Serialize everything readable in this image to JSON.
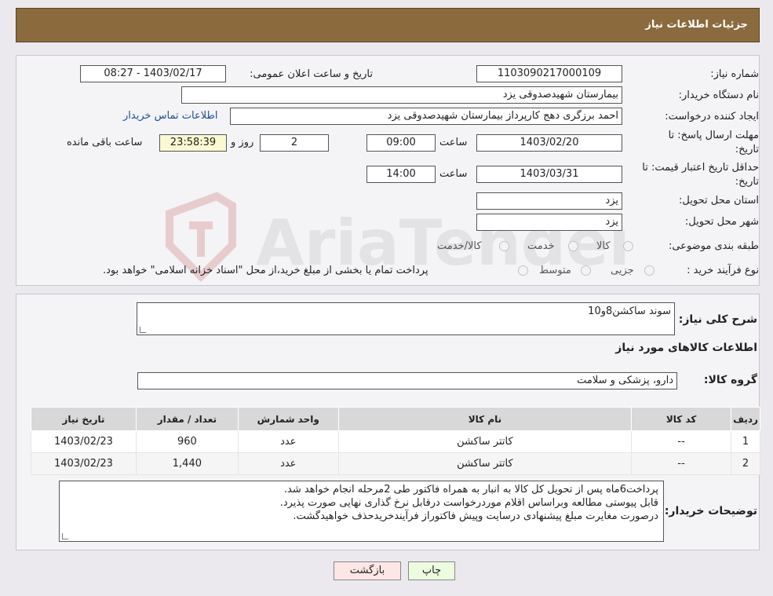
{
  "header": {
    "title": "جزئیات اطلاعات نیاز"
  },
  "form": {
    "need_number_label": "شماره نیاز:",
    "need_number": "1103090217000109",
    "announce_label": "تاریخ و ساعت اعلان عمومی:",
    "announce_value": "1403/02/17 - 08:27",
    "buyer_org_label": "نام دستگاه خریدار:",
    "buyer_org": "بیمارستان شهیدصدوقی یزد",
    "requester_label": "ایجاد کننده درخواست:",
    "requester": "احمد برزگری دهج کارپرداز بیمارستان شهیدصدوقی یزد",
    "contact_link": "اطلاعات تماس خریدار",
    "deadline_label_1": "مهلت ارسال پاسخ: تا",
    "deadline_label_2": "تاریخ:",
    "deadline_date": "1403/02/20",
    "time_label": "ساعت",
    "deadline_time": "09:00",
    "days_value": "2",
    "days_label": "روز و",
    "remaining_time": "23:58:39",
    "remaining_label": "ساعت باقی مانده",
    "validity_label_1": "حداقل تاریخ اعتبار قیمت: تا",
    "validity_label_2": "تاریخ:",
    "validity_date": "1403/03/31",
    "validity_time": "14:00",
    "province_label": "استان محل تحویل:",
    "province": "یزد",
    "city_label": "شهر محل تحویل:",
    "city": "یزد",
    "category_label": "طبقه بندی موضوعی:",
    "category_options": [
      "کالا",
      "خدمت",
      "کالا/خدمت"
    ],
    "process_label": "نوع فرآیند خرید :",
    "process_options": [
      "جزیی",
      "متوسط"
    ],
    "process_note": "پرداخت تمام یا بخشی از مبلغ خرید،از محل \"اسناد خزانه اسلامی\" خواهد بود."
  },
  "details": {
    "summary_label": "شرح کلی نیاز:",
    "summary_value": "سوند ساکشن8و10",
    "goods_info_title": "اطلاعات کالاهای مورد نیاز",
    "group_label": "گروه کالا:",
    "group_value": "دارو، پزشکی و سلامت"
  },
  "table": {
    "headers": [
      "ردیف",
      "کد کالا",
      "نام کالا",
      "واحد شمارش",
      "تعداد / مقدار",
      "تاریخ نیاز"
    ],
    "rows": [
      [
        "1",
        "--",
        "کاتتر ساکشن",
        "عدد",
        "960",
        "1403/02/23"
      ],
      [
        "2",
        "--",
        "کاتتر ساکشن",
        "عدد",
        "1,440",
        "1403/02/23"
      ]
    ]
  },
  "notes": {
    "label": "توضیحات خریدار:",
    "lines": [
      "پرداخت6ماه پس از تحویل کل کالا به انبار به همراه فاکتور طی 2مرحله انجام خواهد شد.",
      "قابل پیوستی مطالعه وبراساس اقلام موردرخواست درقابل نرخ گذاری نهایی  صورت پذیرد.",
      "درصورت مغایرت مبلغ پیشنهادی درسایت وپیش فاکتوراز فرآیندخریدحذف خواهیدگشت."
    ]
  },
  "buttons": {
    "print": "چاپ",
    "back": "بازگشت"
  },
  "colors": {
    "header_bg": "#8b6a3e",
    "remaining_bg": "#fbf9d2",
    "print_bg": "#ecfce0",
    "back_bg": "#fde6e6"
  }
}
